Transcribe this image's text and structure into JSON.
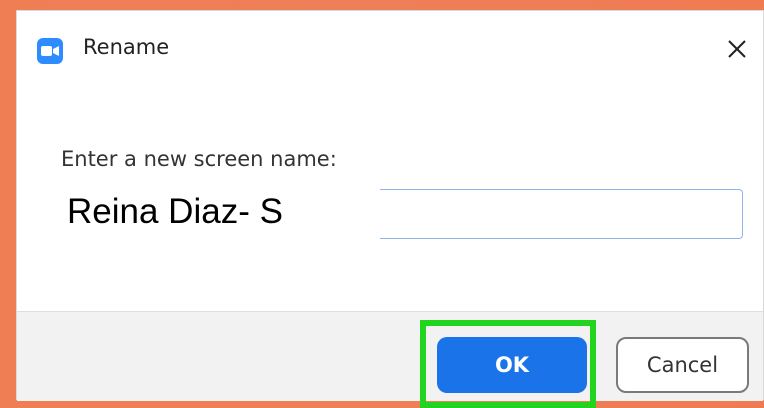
{
  "window": {
    "title": "Rename",
    "app_icon": "zoom-camera-icon",
    "close_icon": "close-icon"
  },
  "form": {
    "prompt": "Enter a new screen name:",
    "name_value": "Reina Diaz- S"
  },
  "buttons": {
    "ok_label": "OK",
    "cancel_label": "Cancel"
  },
  "colors": {
    "background": "#ef7f58",
    "accent": "#1a73e8",
    "highlight": "#23d41e",
    "app_icon": "#2d8cff"
  }
}
